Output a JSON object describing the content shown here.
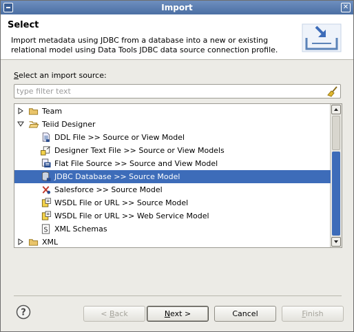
{
  "window": {
    "title": "Import"
  },
  "header": {
    "title": "Select",
    "description": "Import metadata using JDBC from a database into a new or existing relational model using Data Tools JDBC data source connection profile."
  },
  "source_label": {
    "accel": "S",
    "rest": "elect an import source:"
  },
  "filter": {
    "placeholder": "type filter text",
    "value": ""
  },
  "tree": {
    "items": [
      {
        "label": "Team",
        "icon": "folder-icon",
        "twisty": "collapsed",
        "depth": 0,
        "selected": false
      },
      {
        "label": "Teiid Designer",
        "icon": "folder-open-icon",
        "twisty": "expanded",
        "depth": 0,
        "selected": false
      },
      {
        "label": "DDL File >> Source or View Model",
        "icon": "ddl-file-icon",
        "depth": 1,
        "selected": false
      },
      {
        "label": "Designer Text File >> Source or View Models",
        "icon": "text-import-icon",
        "depth": 1,
        "selected": false
      },
      {
        "label": "Flat File Source >> Source and View Model",
        "icon": "flat-file-icon",
        "depth": 1,
        "selected": false
      },
      {
        "label": "JDBC Database >> Source Model",
        "icon": "jdbc-database-icon",
        "depth": 1,
        "selected": true
      },
      {
        "label": "Salesforce >> Source Model",
        "icon": "salesforce-icon",
        "depth": 1,
        "selected": false
      },
      {
        "label": "WSDL File or URL >> Source Model",
        "icon": "wsdl-import-icon",
        "depth": 1,
        "selected": false
      },
      {
        "label": "WSDL File or URL >> Web Service Model",
        "icon": "wsdl-import-icon",
        "depth": 1,
        "selected": false
      },
      {
        "label": "XML Schemas",
        "icon": "xml-schema-icon",
        "depth": 1,
        "selected": false
      },
      {
        "label": "XML",
        "icon": "folder-icon",
        "twisty": "collapsed",
        "depth": 0,
        "selected": false
      }
    ]
  },
  "buttons": {
    "back": {
      "prefix": "< ",
      "accel": "B",
      "rest": "ack",
      "enabled": false
    },
    "next": {
      "prefix": "",
      "accel": "N",
      "rest": "ext >",
      "enabled": true
    },
    "cancel": {
      "label": "Cancel",
      "enabled": true
    },
    "finish": {
      "prefix": "",
      "accel": "F",
      "rest": "inish",
      "enabled": false
    }
  },
  "colors": {
    "selection": "#3d6cb9",
    "titlebar": "#5a7db0"
  }
}
